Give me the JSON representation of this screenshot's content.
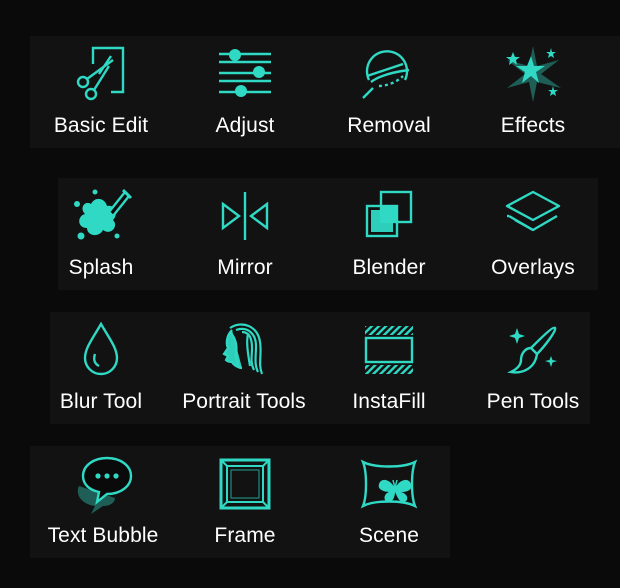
{
  "accent_color": "#2fd9c4",
  "tools": [
    {
      "label": "Basic Edit",
      "icon": "scissors-icon"
    },
    {
      "label": "Adjust",
      "icon": "sliders-icon"
    },
    {
      "label": "Removal",
      "icon": "eraser-icon"
    },
    {
      "label": "Effects",
      "icon": "sparkle-burst-icon"
    },
    {
      "label": "Splash",
      "icon": "paint-splash-icon"
    },
    {
      "label": "Mirror",
      "icon": "mirror-icon"
    },
    {
      "label": "Blender",
      "icon": "blend-squares-icon"
    },
    {
      "label": "Overlays",
      "icon": "layers-icon"
    },
    {
      "label": "Blur Tool",
      "icon": "droplet-icon"
    },
    {
      "label": "Portrait Tools",
      "icon": "portrait-face-icon"
    },
    {
      "label": "InstaFill",
      "icon": "instafill-icon"
    },
    {
      "label": "Pen Tools",
      "icon": "paintbrush-sparkle-icon"
    },
    {
      "label": "Text Bubble",
      "icon": "chat-bubble-icon"
    },
    {
      "label": "Frame",
      "icon": "frame-icon"
    },
    {
      "label": "Scene",
      "icon": "butterfly-scene-icon"
    }
  ]
}
